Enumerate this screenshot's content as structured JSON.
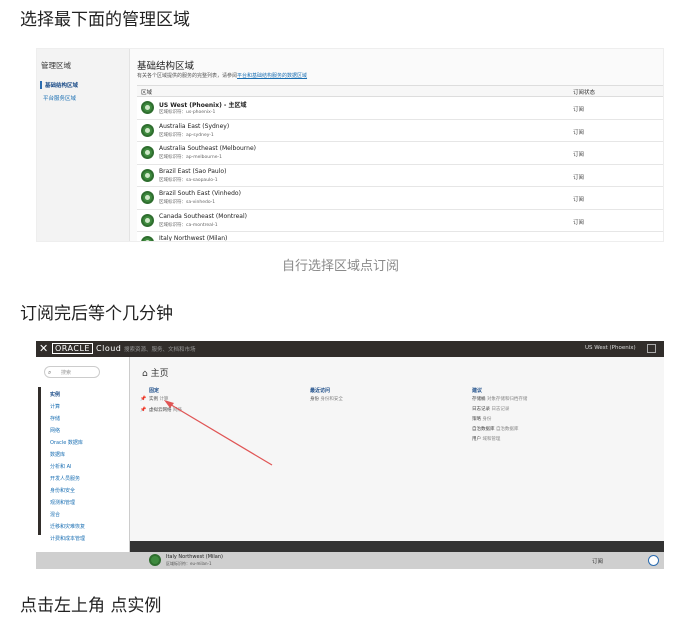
{
  "headings": {
    "h1": "选择最下面的管理区域",
    "h2": "订阅完后等个几分钟",
    "h3": "点击左上角 点实例"
  },
  "caption": "自行选择区域点订阅",
  "shot1": {
    "side_title": "管理区域",
    "side_items": [
      "基础结构区域",
      "平台服务区域"
    ],
    "title": "基础结构区域",
    "subtitle": "有关各个区域提供的服务的完整列表，请参阅",
    "subtitle_link": "平台和基础结构服务的数据区域",
    "col_region": "区域",
    "col_status": "订阅状态",
    "rows": [
      {
        "name": "US West (Phoenix) - 主区域",
        "id": "区域标识符：us-phoenix-1",
        "status": "订阅"
      },
      {
        "name": "Australia East (Sydney)",
        "id": "区域标识符：ap-sydney-1",
        "status": "订阅"
      },
      {
        "name": "Australia Southeast (Melbourne)",
        "id": "区域标识符：ap-melbourne-1",
        "status": "订阅"
      },
      {
        "name": "Brazil East (Sao Paulo)",
        "id": "区域标识符：sa-saopaulo-1",
        "status": "订阅"
      },
      {
        "name": "Brazil South East (Vinhedo)",
        "id": "区域标识符：sa-vinhedo-1",
        "status": "订阅"
      },
      {
        "name": "Canada Southeast (Montreal)",
        "id": "区域标识符：ca-montreal-1",
        "status": "订阅"
      },
      {
        "name": "Italy Northwest (Milan)",
        "id": "区域标识符",
        "status": "订阅"
      }
    ]
  },
  "shot2": {
    "logo_a": "ORACLE",
    "logo_b": "Cloud",
    "search": "搜索资源、服务、文档和市场",
    "region": "US West (Phoenix)",
    "menu_search": "搜索",
    "menu_items": [
      "实例",
      "计算",
      "存储",
      "网络",
      "Oracle 数据库",
      "数据库",
      "分析和 AI",
      "开发人员服务",
      "身份和安全",
      "观测和管理",
      "混合",
      "迁移和灾难恢复",
      "计费和成本管理"
    ],
    "home": "主页",
    "col1_head": "固定",
    "col1_items": [
      {
        "a": "实例",
        "b": "计算"
      },
      {
        "a": "虚拟云网络",
        "b": "网络"
      }
    ],
    "col2_head": "最近访问",
    "col2_items": [
      {
        "a": "身份",
        "b": "身份和安全"
      }
    ],
    "col3_head": "建议",
    "col3_items": [
      {
        "a": "存储桶",
        "b": "对象存储和归档存储"
      },
      {
        "a": "日志记录",
        "b": "日志记录"
      },
      {
        "a": "策略",
        "b": "身份"
      },
      {
        "a": "自治数据库",
        "b": "自治数据库"
      },
      {
        "a": "用户",
        "b": "域和管理"
      }
    ],
    "bottom_name": "Italy Northwest (Milan)",
    "bottom_id": "区域标识符：eu-milan-1",
    "bottom_status": "订阅"
  },
  "colors": {
    "accent": "#1a6fb3",
    "oracle_bar": "#312d2a",
    "region_green": "#3e8a3e",
    "annotation_arrow": "#e05555"
  },
  "icons": {
    "region": "globe-icon",
    "close": "close-icon",
    "search": "search-icon",
    "pin": "pin-icon",
    "help": "help-icon"
  }
}
